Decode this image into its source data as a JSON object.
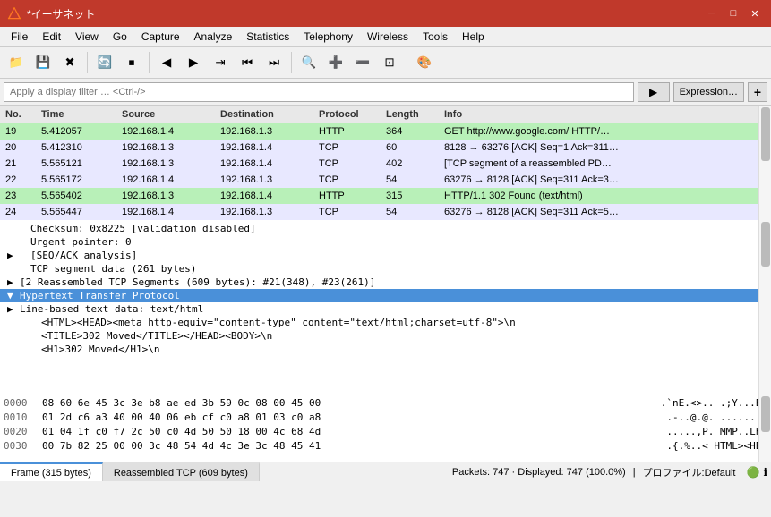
{
  "titlebar": {
    "title": "*イーサネット",
    "icon": "shark",
    "min_label": "─",
    "max_label": "□",
    "close_label": "✕"
  },
  "menubar": {
    "items": [
      {
        "label": "File",
        "id": "file"
      },
      {
        "label": "Edit",
        "id": "edit"
      },
      {
        "label": "View",
        "id": "view"
      },
      {
        "label": "Go",
        "id": "go"
      },
      {
        "label": "Capture",
        "id": "capture"
      },
      {
        "label": "Analyze",
        "id": "analyze"
      },
      {
        "label": "Statistics",
        "id": "statistics"
      },
      {
        "label": "Telephony",
        "id": "telephony"
      },
      {
        "label": "Wireless",
        "id": "wireless"
      },
      {
        "label": "Tools",
        "id": "tools"
      },
      {
        "label": "Help",
        "id": "help"
      }
    ]
  },
  "filterbar": {
    "placeholder": "Apply a display filter … <Ctrl-/>",
    "arrow_label": "▶",
    "expression_label": "Expression…",
    "plus_label": "+"
  },
  "packet_list": {
    "headers": [
      "No.",
      "Time",
      "Source",
      "Destination",
      "Protocol",
      "Length",
      "Info"
    ],
    "rows": [
      {
        "no": "19",
        "time": "5.412057",
        "source": "192.168.1.4",
        "dest": "192.168.1.3",
        "protocol": "HTTP",
        "length": "364",
        "info": "GET http://www.google.com/ HTTP/…",
        "style": "green"
      },
      {
        "no": "20",
        "time": "5.412310",
        "source": "192.168.1.3",
        "dest": "192.168.1.4",
        "protocol": "TCP",
        "length": "60",
        "info": "8128 → 63276 [ACK] Seq=1 Ack=311…",
        "style": "tcp"
      },
      {
        "no": "21",
        "time": "5.565121",
        "source": "192.168.1.3",
        "dest": "192.168.1.4",
        "protocol": "TCP",
        "length": "402",
        "info": "[TCP segment of a reassembled PD…",
        "style": "tcp"
      },
      {
        "no": "22",
        "time": "5.565172",
        "source": "192.168.1.4",
        "dest": "192.168.1.3",
        "protocol": "TCP",
        "length": "54",
        "info": "63276 → 8128 [ACK] Seq=311 Ack=3…",
        "style": "tcp"
      },
      {
        "no": "23",
        "time": "5.565402",
        "source": "192.168.1.3",
        "dest": "192.168.1.4",
        "protocol": "HTTP",
        "length": "315",
        "info": "HTTP/1.1 302 Found  (text/html)",
        "style": "green"
      },
      {
        "no": "24",
        "time": "5.565447",
        "source": "192.168.1.4",
        "dest": "192.168.1.3",
        "protocol": "TCP",
        "length": "54",
        "info": "63276 → 8128 [ACK] Seq=311 Ack=5…",
        "style": "tcp"
      }
    ]
  },
  "details": {
    "rows": [
      {
        "text": "Checksum: 0x8225 [validation disabled]",
        "indent": 1,
        "expandable": false,
        "selected": false
      },
      {
        "text": "Urgent pointer: 0",
        "indent": 1,
        "expandable": false,
        "selected": false
      },
      {
        "text": "[SEQ/ACK analysis]",
        "indent": 1,
        "expandable": true,
        "selected": false
      },
      {
        "text": "TCP segment data (261 bytes)",
        "indent": 1,
        "expandable": false,
        "selected": false
      },
      {
        "text": "[2 Reassembled TCP Segments (609 bytes): #21(348), #23(261)]",
        "indent": 0,
        "expandable": true,
        "selected": false
      },
      {
        "text": "Hypertext Transfer Protocol",
        "indent": 0,
        "expandable": true,
        "selected": true
      },
      {
        "text": "Line-based text data: text/html",
        "indent": 0,
        "expandable": true,
        "selected": false
      },
      {
        "text": "  <HTML><HEAD><meta http-equiv=\"content-type\" content=\"text/html;charset=utf-8\">\\n",
        "indent": 2,
        "expandable": false,
        "selected": false
      },
      {
        "text": "  <TITLE>302 Moved</TITLE></HEAD><BODY>\\n",
        "indent": 2,
        "expandable": false,
        "selected": false
      },
      {
        "text": "  <H1>302 Moved</H1>\\n",
        "indent": 2,
        "expandable": false,
        "selected": false
      }
    ]
  },
  "hex": {
    "rows": [
      {
        "offset": "0000",
        "bytes": "08 60 6e 45 3c 3e b8 ae  ed 3b 59 0c 08 00 45 00",
        "ascii": ".`nE.<>.. .;Y...E."
      },
      {
        "offset": "0010",
        "bytes": "01 2d c6 a3 40 00 40 06  eb cf c0 a8 01 03 c0 a8",
        "ascii": ".-..@.@. ........"
      },
      {
        "offset": "0020",
        "bytes": "01 04 1f c0 f7 2c 50 c0  4d 50 50 18 00 4c 68 4d",
        "ascii": ".....,P. MMP..LhM"
      },
      {
        "offset": "0030",
        "bytes": "00 7b 82 25 00 00 3c 48  54 4d 4c 3e 3c 48 45 41",
        "ascii": ".{.%..< HTML><HEA"
      }
    ]
  },
  "statusbar": {
    "tabs": [
      {
        "label": "Frame (315 bytes)",
        "active": true
      },
      {
        "label": "Reassembled TCP (609 bytes)",
        "active": false
      }
    ],
    "right_text": "Packets: 747 · Displayed: 747 (100.0%)",
    "profile_text": "プロファイル:Default"
  }
}
